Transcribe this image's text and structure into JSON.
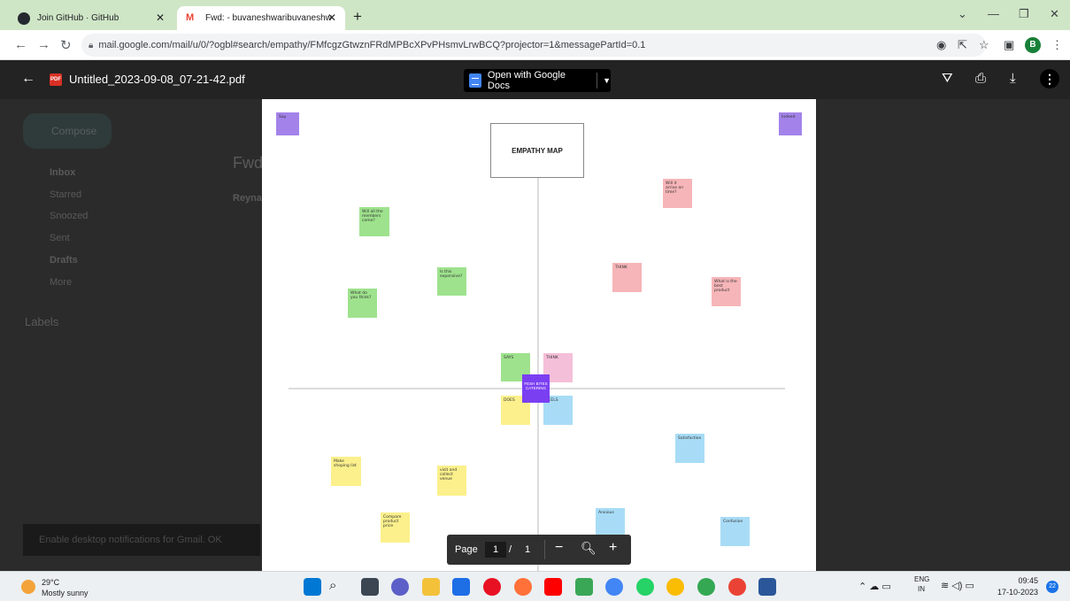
{
  "browser": {
    "tabs": [
      {
        "title": "Join GitHub · GitHub"
      },
      {
        "title": "Fwd: - buvaneshwaribuvaneshw"
      }
    ],
    "url": "mail.google.com/mail/u/0/?ogbl#search/empathy/FMfcgzGtwznFRdMPBcXPvPHsmvLrwBCQ?projector=1&messagePartId=0.1",
    "profile_initial": "B"
  },
  "viewer": {
    "filename": "Untitled_2023-09-08_07-21-42.pdf",
    "file_type_badge": "PDF",
    "open_with_label": "Open with Google Docs",
    "pagination": {
      "label": "Page",
      "current": "1",
      "separator": "/",
      "total": "1"
    }
  },
  "gmail_background": {
    "compose": "Compose",
    "nav": [
      "Inbox",
      "Starred",
      "Snoozed",
      "Sent",
      "Drafts",
      "More"
    ],
    "labels_heading": "Labels",
    "subject_fragment": "Fwd",
    "sender_fragment": "Reyna",
    "toast": "Enable desktop notifications for Gmail.   OK"
  },
  "empathy_map": {
    "title": "EMPATHY MAP",
    "center_label": "FESH BITES CATERING",
    "quadrants": {
      "says": "SAYS",
      "thinks": "THINK",
      "does": "DOES",
      "feels": "FEELS"
    },
    "notes": [
      {
        "id": "n1",
        "text": "Will all the members come?",
        "color": "green"
      },
      {
        "id": "n2",
        "text": "Is this expensive?",
        "color": "green"
      },
      {
        "id": "n3",
        "text": "What do you think?",
        "color": "green"
      },
      {
        "id": "n4",
        "text": "Will it arrive on time?",
        "color": "pink"
      },
      {
        "id": "n5",
        "text": "THINK",
        "color": "pink"
      },
      {
        "id": "n6",
        "text": "What is the best product",
        "color": "pink"
      },
      {
        "id": "n7",
        "text": "Satisfaction",
        "color": "blue"
      },
      {
        "id": "n8",
        "text": "Anxious",
        "color": "blue"
      },
      {
        "id": "n9",
        "text": "Confusion",
        "color": "blue"
      },
      {
        "id": "n10",
        "text": "Make shoping list",
        "color": "yellow"
      },
      {
        "id": "n11",
        "text": "visit and collect venue",
        "color": "yellow"
      },
      {
        "id": "n12",
        "text": "Compare product price",
        "color": "yellow"
      }
    ],
    "corner_labels": {
      "left": "Say",
      "right": "Indeed"
    }
  },
  "taskbar": {
    "temperature": "29°C",
    "condition": "Mostly sunny",
    "lang_top": "ENG",
    "lang_bottom": "IN",
    "time": "09:45",
    "date": "17-10-2023",
    "notification_count": "22"
  }
}
